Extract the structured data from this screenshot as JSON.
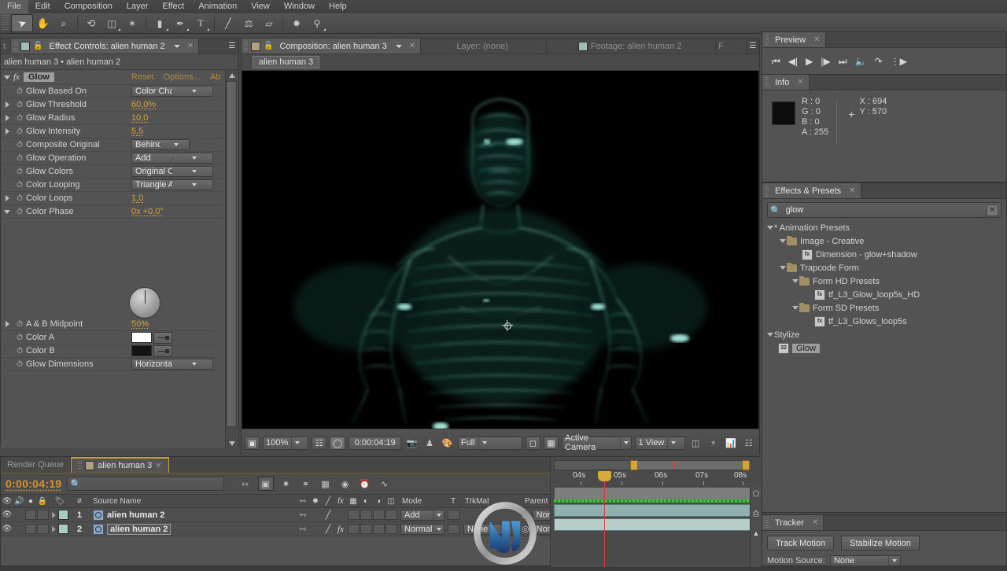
{
  "menu": {
    "items": [
      "File",
      "Edit",
      "Composition",
      "Layer",
      "Effect",
      "Animation",
      "View",
      "Window",
      "Help"
    ]
  },
  "toolbar": {
    "tools": [
      {
        "name": "selection-tool",
        "glyph": "➤",
        "selected": true
      },
      {
        "name": "hand-tool",
        "glyph": "✋",
        "selected": false
      },
      {
        "name": "zoom-tool",
        "glyph": "⌕",
        "selected": false
      },
      {
        "name": "rotation-tool",
        "glyph": "↻",
        "selected": false
      },
      {
        "name": "camera-tool",
        "glyph": "✇",
        "selected": false
      },
      {
        "name": "pan-behind-tool",
        "glyph": "✶",
        "selected": false
      },
      {
        "name": "shape-tool",
        "glyph": "▬",
        "selected": false
      },
      {
        "name": "pen-tool",
        "glyph": "✒",
        "selected": false
      },
      {
        "name": "type-tool",
        "glyph": "T",
        "selected": false
      },
      {
        "name": "brush-tool",
        "glyph": "╱",
        "selected": false
      },
      {
        "name": "clone-stamp-tool",
        "glyph": "⚙",
        "selected": false
      },
      {
        "name": "eraser-tool",
        "glyph": "▱",
        "selected": false
      },
      {
        "name": "roto-brush-tool",
        "glyph": "✒",
        "selected": false
      },
      {
        "name": "puppet-pin-tool",
        "glyph": "✒",
        "selected": false
      }
    ]
  },
  "effect_controls": {
    "partial_tab_label": "t",
    "tab_title": "Effect Controls: alien human 2",
    "breadcrumb": "alien human 3 • alien human 2",
    "effect_name": "Glow",
    "links": [
      "Reset",
      "Options...",
      "Ab"
    ],
    "properties": [
      {
        "label": "Glow Based On",
        "type": "dropdown",
        "value": "Color Channels",
        "twirl": "none"
      },
      {
        "label": "Glow Threshold",
        "type": "value",
        "value": "60,0%",
        "twirl": "right"
      },
      {
        "label": "Glow Radius",
        "type": "value",
        "value": "10,0",
        "twirl": "right"
      },
      {
        "label": "Glow Intensity",
        "type": "value",
        "value": "5,5",
        "twirl": "right"
      },
      {
        "label": "Composite Original",
        "type": "dropdown",
        "value": "Behind",
        "twirl": "none",
        "narrow": true
      },
      {
        "label": "Glow Operation",
        "type": "dropdown",
        "value": "Add",
        "twirl": "none"
      },
      {
        "label": "Glow Colors",
        "type": "dropdown",
        "value": "Original Colors",
        "twirl": "none"
      },
      {
        "label": "Color Looping",
        "type": "dropdown",
        "value": "Triangle A>B>A",
        "twirl": "none"
      },
      {
        "label": "Color Loops",
        "type": "value",
        "value": "1,0",
        "twirl": "right"
      },
      {
        "label": "Color Phase",
        "type": "value",
        "value": "0x +0,0°",
        "twirl": "down"
      },
      {
        "label": "A & B Midpoint",
        "type": "value",
        "value": "50%",
        "twirl": "right"
      },
      {
        "label": "Color A",
        "type": "color",
        "value": "#ffffff",
        "twirl": "none"
      },
      {
        "label": "Color B",
        "type": "color",
        "value": "#131313",
        "twirl": "none"
      },
      {
        "label": "Glow Dimensions",
        "type": "dropdown",
        "value": "Horizontal an...",
        "twirl": "none"
      }
    ]
  },
  "composition": {
    "tabs": [
      {
        "label": "Composition: alien human 3",
        "active": true,
        "has_dropdown": true
      },
      {
        "label": "Layer: (none)",
        "active": false,
        "has_dropdown": false
      },
      {
        "label": "Footage: alien human 2",
        "active": false,
        "has_dropdown": false
      },
      {
        "label": "F",
        "active": false,
        "has_dropdown": false
      }
    ],
    "breadcrumb": "alien human 3",
    "viewer_bar": {
      "magnification": "100%",
      "time": "0:00:04:19",
      "resolution": "Full",
      "camera": "Active Camera",
      "views": "1 View"
    }
  },
  "preview": {
    "tab": "Preview",
    "buttons": [
      {
        "name": "first-frame-button",
        "glyph": "⏮"
      },
      {
        "name": "previous-frame-button",
        "glyph": "◁|"
      },
      {
        "name": "play-button",
        "glyph": "▶"
      },
      {
        "name": "next-frame-button",
        "glyph": "|▷"
      },
      {
        "name": "last-frame-button",
        "glyph": "⏭"
      },
      {
        "name": "audio-button",
        "glyph": "🔈"
      },
      {
        "name": "loop-button",
        "glyph": "↻"
      },
      {
        "name": "ram-preview-button",
        "glyph": "⫼▶"
      }
    ]
  },
  "info": {
    "tab": "Info",
    "swatch_color": "#0d0d0d",
    "channels": [
      "R : 0",
      "G : 0",
      "B : 0",
      "A : 255"
    ],
    "coords": [
      "X : 694",
      "Y : 570"
    ]
  },
  "effects_presets": {
    "tab": "Effects & Presets",
    "search_value": "glow",
    "search_placeholder": "",
    "tree": [
      {
        "label": "* Animation Presets",
        "depth": 0,
        "kind": "group",
        "expanded": true
      },
      {
        "label": "Image - Creative",
        "depth": 1,
        "kind": "folder",
        "expanded": true
      },
      {
        "label": "Dimension - glow+shadow",
        "depth": 2,
        "kind": "preset",
        "expanded": false
      },
      {
        "label": "Trapcode Form",
        "depth": 1,
        "kind": "folder",
        "expanded": true
      },
      {
        "label": "Form HD Presets",
        "depth": 2,
        "kind": "folder",
        "expanded": true
      },
      {
        "label": "tf_L3_Glow_loop5s_HD",
        "depth": 3,
        "kind": "preset",
        "expanded": false
      },
      {
        "label": "Form SD Presets",
        "depth": 2,
        "kind": "folder",
        "expanded": true
      },
      {
        "label": "tf_L3_Glows_loop5s",
        "depth": 3,
        "kind": "preset",
        "expanded": false
      },
      {
        "label": "Stylize",
        "depth": 0,
        "kind": "group",
        "expanded": true
      },
      {
        "label": "Glow",
        "depth": 1,
        "kind": "effect",
        "expanded": false,
        "selected": true
      }
    ]
  },
  "timeline": {
    "tabs": [
      {
        "label": "Render Queue",
        "active": false
      },
      {
        "label": "alien human 3",
        "active": true
      }
    ],
    "current_time": "0:00:04:19",
    "search_placeholder": "",
    "columns": [
      "#",
      "Source Name",
      "Mode",
      "T",
      "TrkMat",
      "Parent"
    ],
    "layers": [
      {
        "index": "1",
        "source_name": "alien human 2",
        "mode": "Add",
        "trkmat": "",
        "parent": "None",
        "has_fx": false,
        "name_boxed": false
      },
      {
        "index": "2",
        "source_name": "alien human 2",
        "mode": "Normal",
        "trkmat": "None",
        "parent": "None",
        "has_fx": true,
        "name_boxed": true
      }
    ],
    "ruler_ticks": [
      "04s",
      "05s",
      "06s",
      "07s",
      "08s"
    ]
  },
  "tracker": {
    "tab": "Tracker",
    "track_motion_label": "Track Motion",
    "stabilize_motion_label": "Stabilize Motion",
    "motion_source_label": "Motion Source:",
    "motion_source_value": "None"
  },
  "colors": {
    "accent_orange": "#d4932c",
    "panel_bg": "#535353",
    "glow_teal": "#7fe8d4",
    "playhead_red": "#d93c3c"
  }
}
